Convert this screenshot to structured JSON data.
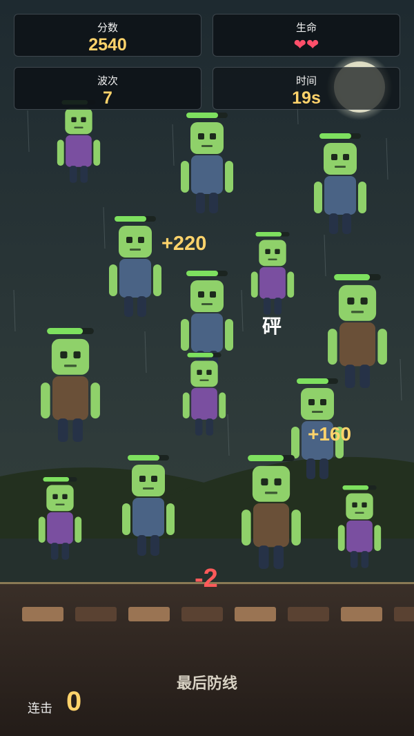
{
  "hud": {
    "score": {
      "label": "分数",
      "value": "2540"
    },
    "lives": {
      "label": "生命",
      "value": "❤❤"
    },
    "wave": {
      "label": "波次",
      "value": "7"
    },
    "time": {
      "label": "时间",
      "value": "19s"
    }
  },
  "popups": {
    "score_a": "+220",
    "score_b": "+160",
    "hit": "砰",
    "damage": "-2"
  },
  "footer": {
    "title": "最后防线",
    "combo_label": "连击",
    "combo_value": "0"
  },
  "colors": {
    "accent": "#ffd36b",
    "heart": "#ff4f6a",
    "damage": "#ff5a5a",
    "zombie_skin": "#8fd16a",
    "health_bar": "#7ee05f"
  },
  "zombies": [
    {
      "shirt": "purple",
      "size": "small"
    },
    {
      "shirt": "blue",
      "size": "medium"
    },
    {
      "shirt": "blue",
      "size": "medium"
    },
    {
      "shirt": "blue",
      "size": "medium"
    },
    {
      "shirt": "purple",
      "size": "small"
    },
    {
      "shirt": "blue",
      "size": "medium"
    },
    {
      "shirt": "brown",
      "size": "large"
    },
    {
      "shirt": "brown",
      "size": "large"
    },
    {
      "shirt": "purple",
      "size": "small"
    },
    {
      "shirt": "blue",
      "size": "medium"
    },
    {
      "shirt": "blue",
      "size": "medium"
    },
    {
      "shirt": "purple",
      "size": "small"
    },
    {
      "shirt": "brown",
      "size": "large"
    },
    {
      "shirt": "purple",
      "size": "small"
    }
  ]
}
